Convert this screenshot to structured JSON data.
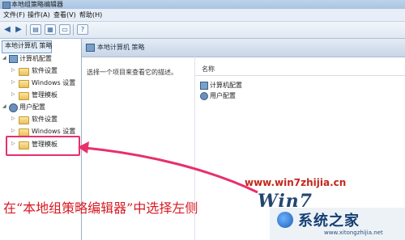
{
  "window": {
    "title": "本地组策略编辑器"
  },
  "menu": [
    "文件(F)",
    "操作(A)",
    "查看(V)",
    "帮助(H)"
  ],
  "toolbar": {
    "buttons": [
      "back",
      "forward",
      "up",
      "show-hide",
      "export",
      "help"
    ]
  },
  "tree": {
    "root": "本地计算机 策略",
    "computer_config": {
      "label": "计算机配置",
      "children": [
        "软件设置",
        "Windows 设置",
        "管理模板"
      ]
    },
    "user_config": {
      "label": "用户配置",
      "children": [
        "软件设置",
        "Windows 设置",
        "管理模板"
      ]
    }
  },
  "right": {
    "header_title": "本地计算机 策略",
    "description": "选择一个项目来查看它的描述。",
    "column_header": "名称",
    "items": [
      "计算机配置",
      "用户配置"
    ]
  },
  "overlay": {
    "caption": "在“本地组策略编辑器”中选择左侧",
    "watermark_url": "www.win7zhijia.cn",
    "win_logo": "Win7",
    "brand_name": "系统之家",
    "brand_url": "www.xitongzhijia.net",
    "highlight_color": "#e8306a"
  }
}
